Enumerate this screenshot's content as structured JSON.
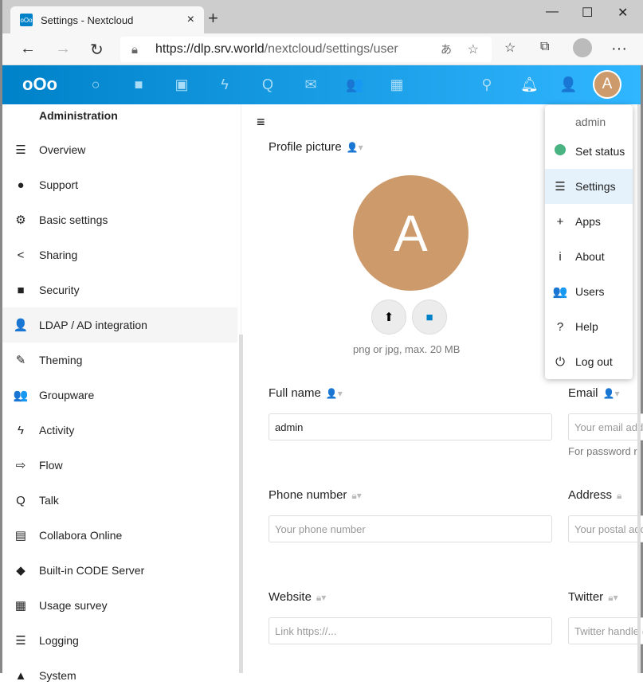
{
  "browser": {
    "tab_title": "Settings - Nextcloud",
    "url_host": "https://dlp.srv.world",
    "url_path": "/nextcloud/settings/user"
  },
  "colors": {
    "brand": "#0082c9",
    "avatar": "#cd9b6b",
    "status_online": "#49b382"
  },
  "sidebar": {
    "heading": "Administration",
    "items": [
      {
        "label": "Overview",
        "icon": "list-icon",
        "glyph": "☰"
      },
      {
        "label": "Support",
        "icon": "speech-bubble-icon",
        "glyph": "●"
      },
      {
        "label": "Basic settings",
        "icon": "gear-icon",
        "glyph": "⚙"
      },
      {
        "label": "Sharing",
        "icon": "share-icon",
        "glyph": "<"
      },
      {
        "label": "Security",
        "icon": "lock-icon",
        "glyph": "■"
      },
      {
        "label": "LDAP / AD integration",
        "icon": "user-icon",
        "glyph": "👤"
      },
      {
        "label": "Theming",
        "icon": "brush-icon",
        "glyph": "✎"
      },
      {
        "label": "Groupware",
        "icon": "users-icon",
        "glyph": "👥"
      },
      {
        "label": "Activity",
        "icon": "lightning-icon",
        "glyph": "ϟ"
      },
      {
        "label": "Flow",
        "icon": "flow-icon",
        "glyph": "⇨"
      },
      {
        "label": "Talk",
        "icon": "talk-icon",
        "glyph": "Q"
      },
      {
        "label": "Collabora Online",
        "icon": "document-icon",
        "glyph": "▤"
      },
      {
        "label": "Built-in CODE Server",
        "icon": "code-icon",
        "glyph": "◆"
      },
      {
        "label": "Usage survey",
        "icon": "survey-icon",
        "glyph": "▦"
      },
      {
        "label": "Logging",
        "icon": "list-icon",
        "glyph": "☰"
      },
      {
        "label": "System",
        "icon": "system-icon",
        "glyph": "▲"
      }
    ]
  },
  "main": {
    "profile_picture": "Profile picture",
    "avatar_letter": "A",
    "avatar_hint": "png or jpg, max. 20 MB",
    "full_name": {
      "label": "Full name",
      "value": "admin"
    },
    "email": {
      "label": "Email",
      "placeholder": "Your email address",
      "hint": "For password reset and notifications"
    },
    "phone": {
      "label": "Phone number",
      "placeholder": "Your phone number"
    },
    "address": {
      "label": "Address",
      "placeholder": "Your postal address"
    },
    "website": {
      "label": "Website",
      "placeholder": "Link https://..."
    },
    "twitter": {
      "label": "Twitter",
      "placeholder": "Twitter handle @..."
    }
  },
  "menu": {
    "user": "admin",
    "items": [
      {
        "label": "Set status",
        "icon": "status-dot-icon"
      },
      {
        "label": "Settings",
        "icon": "settings-list-icon",
        "glyph": "☰"
      },
      {
        "label": "Apps",
        "icon": "plus-icon",
        "glyph": "+"
      },
      {
        "label": "About",
        "icon": "info-icon",
        "glyph": "i"
      },
      {
        "label": "Users",
        "icon": "users-icon",
        "glyph": "👥"
      },
      {
        "label": "Help",
        "icon": "help-icon",
        "glyph": "?"
      },
      {
        "label": "Log out",
        "icon": "power-icon",
        "glyph": "⏻"
      }
    ]
  }
}
